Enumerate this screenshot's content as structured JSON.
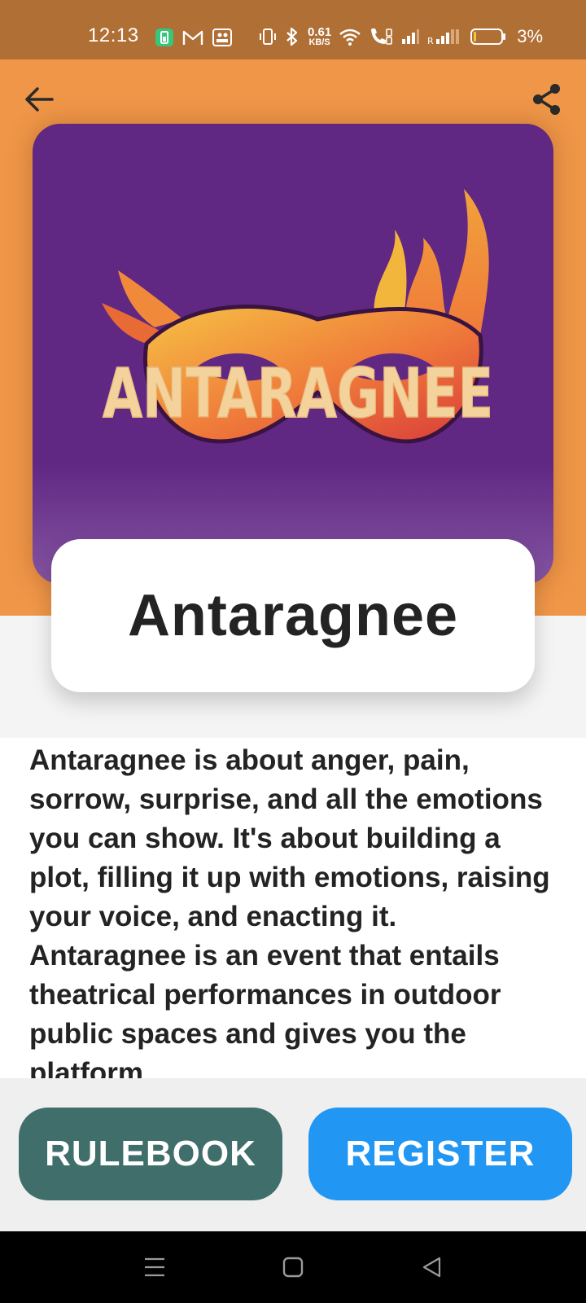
{
  "status_bar": {
    "time": "12:13",
    "net_speed_value": "0.61",
    "net_speed_unit": "KB/S",
    "battery_percent": "3%",
    "icons": [
      "battery-saver-icon",
      "gmail-icon",
      "gallery-icon",
      "vibrate-icon",
      "bluetooth-icon",
      "wifi-icon",
      "volte-call-icon",
      "signal-icon",
      "roaming-signal-icon",
      "battery-icon"
    ]
  },
  "header": {
    "back_icon": "arrow-left-icon",
    "share_icon": "share-icon"
  },
  "poster": {
    "logo_text": "ANTARAGNEE",
    "background_color": "#602783"
  },
  "event": {
    "title": "Antaragnee",
    "description": "Antaragnee is about anger, pain, sorrow, surprise, and all the emotions you can show. It's about building a plot, filling it up with emotions, raising your voice, and enacting it. Antaragnee is an event that entails theatrical performances in outdoor public spaces and gives you the platform"
  },
  "actions": {
    "rulebook_label": "RULEBOOK",
    "register_label": "REGISTER"
  },
  "colors": {
    "status_bar": "#b06f35",
    "hero": "#ef9648",
    "rulebook": "#3f6e6b",
    "register": "#2196f2"
  },
  "nav_bar": {
    "icons": [
      "menu-icon",
      "home-square-icon",
      "back-triangle-icon"
    ]
  }
}
